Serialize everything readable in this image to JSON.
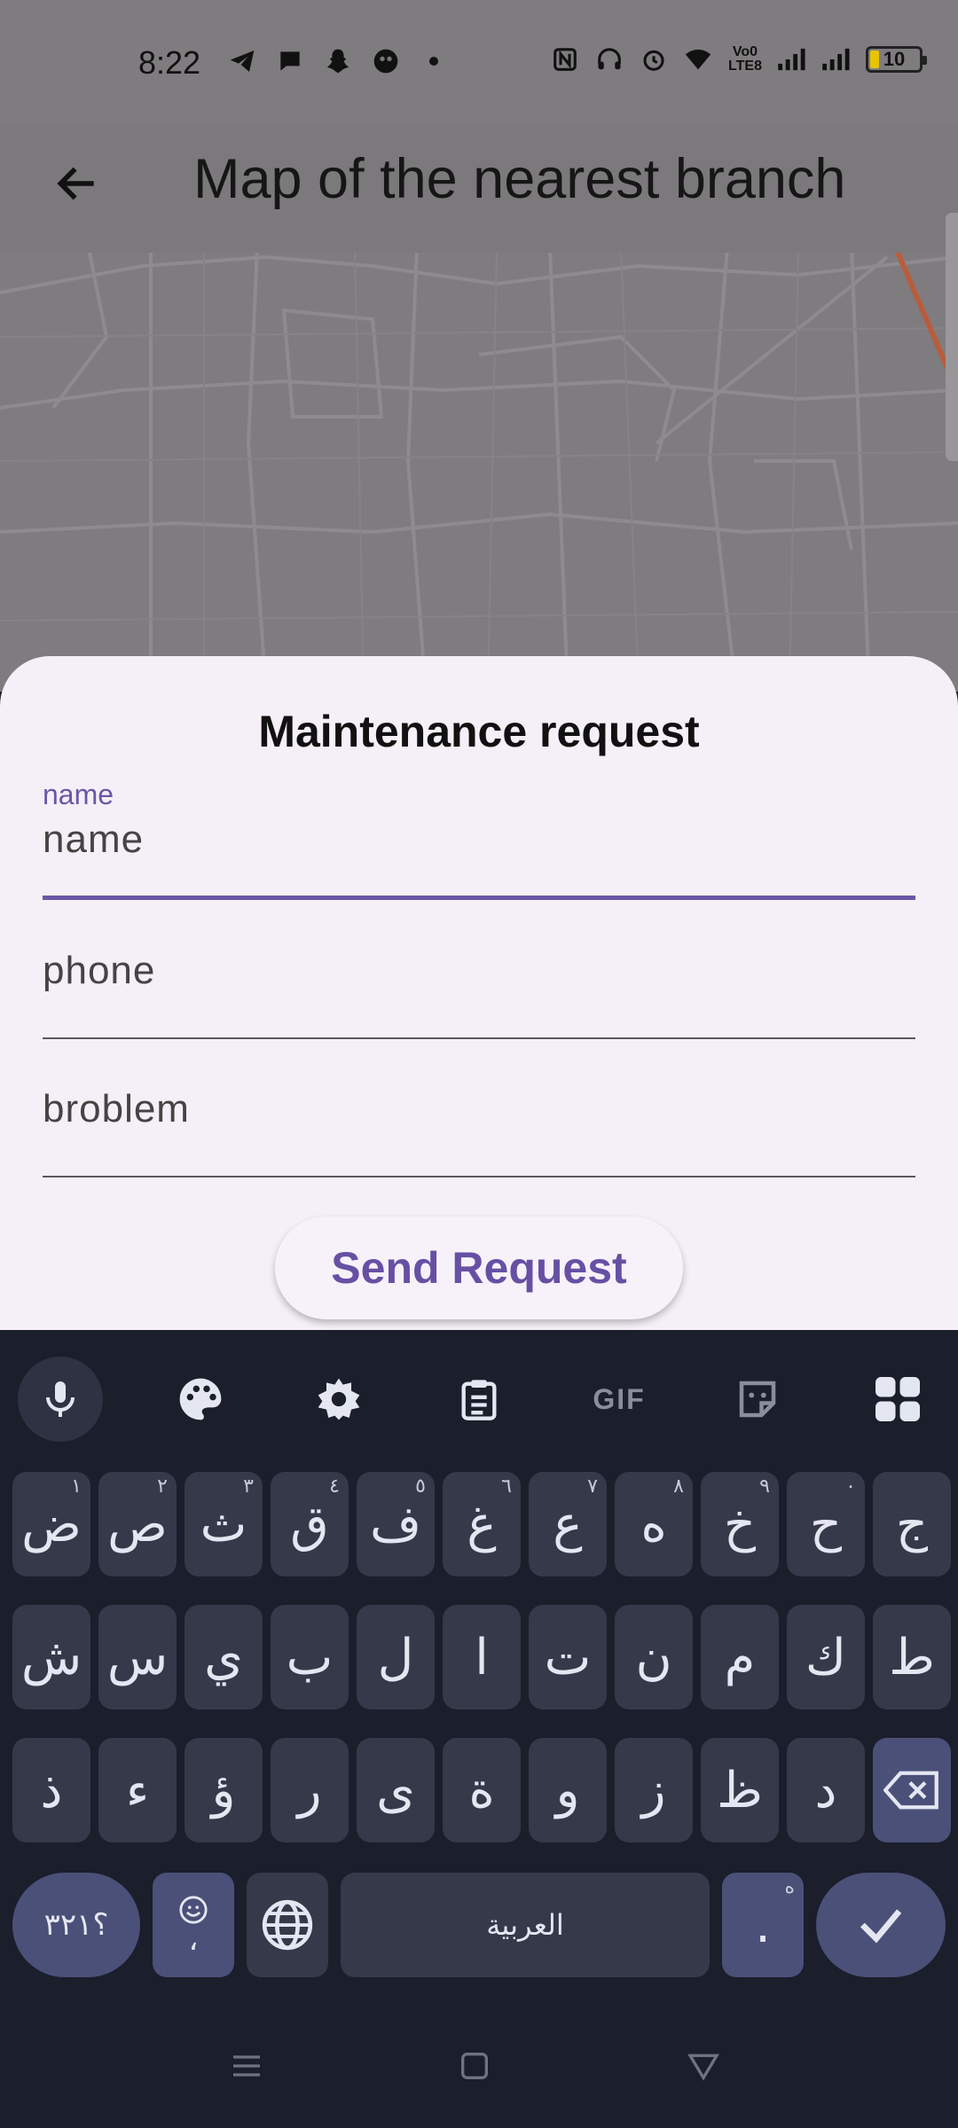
{
  "status_bar": {
    "time": "8:22",
    "network_label": "Vo0 LTE8",
    "battery": "10"
  },
  "app_bar": {
    "title": "Map of the nearest branch"
  },
  "sheet": {
    "title": "Maintenance request",
    "fields": [
      {
        "floating_label": "name",
        "value": "name",
        "active": true
      },
      {
        "floating_label": "",
        "value": "phone",
        "active": false
      },
      {
        "floating_label": "",
        "value": "broblem",
        "active": false
      }
    ],
    "send_button": "Send Request"
  },
  "keyboard": {
    "toolbar": {
      "items": [
        "mic-icon",
        "palette-icon",
        "settings-icon",
        "clipboard-icon",
        "GIF",
        "sticker-icon",
        "apps-icon"
      ]
    },
    "row1": [
      {
        "char": "ض",
        "hint": "١"
      },
      {
        "char": "ص",
        "hint": "٢"
      },
      {
        "char": "ث",
        "hint": "٣"
      },
      {
        "char": "ق",
        "hint": "٤"
      },
      {
        "char": "ف",
        "hint": "٥"
      },
      {
        "char": "غ",
        "hint": "٦"
      },
      {
        "char": "ع",
        "hint": "٧"
      },
      {
        "char": "ه",
        "hint": "٨"
      },
      {
        "char": "خ",
        "hint": "٩"
      },
      {
        "char": "ح",
        "hint": "٠"
      },
      {
        "char": "ج",
        "hint": ""
      }
    ],
    "row2": [
      "ش",
      "س",
      "ي",
      "ب",
      "ل",
      "ا",
      "ت",
      "ن",
      "م",
      "ك",
      "ط"
    ],
    "row3": [
      "ذ",
      "ء",
      "ؤ",
      "ر",
      "ى",
      "ة",
      "و",
      "ز",
      "ظ",
      "د"
    ],
    "symbols_key": "؟٣٢١",
    "comma_key": "،",
    "space_label": "العربية",
    "period_key": "."
  }
}
